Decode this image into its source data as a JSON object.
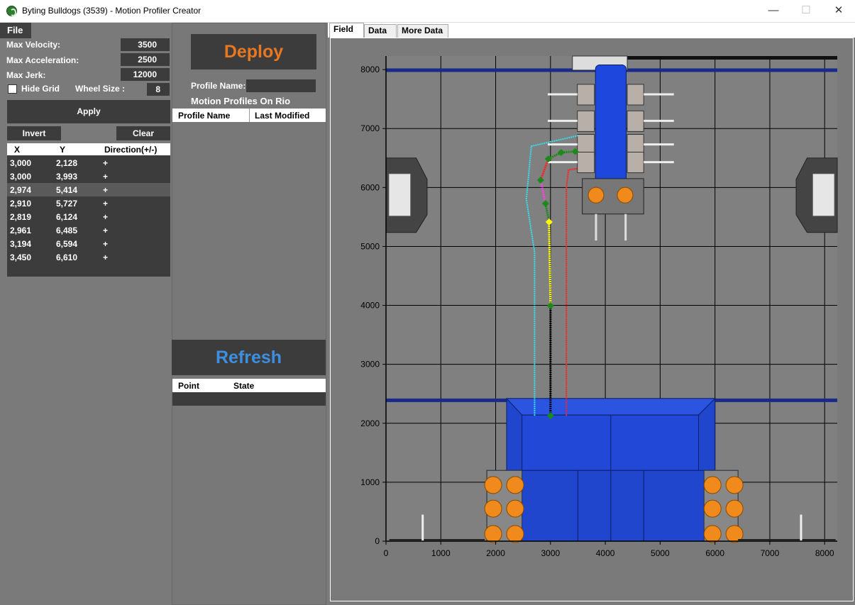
{
  "window": {
    "title": "Byting Bulldogs (3539) - Motion Profiler Creator",
    "min_glyph": "—",
    "max_glyph": "☐",
    "close_glyph": "✕"
  },
  "menu": {
    "file": "File"
  },
  "settings": {
    "max_velocity_label": "Max Velocity:",
    "max_velocity": "3500",
    "max_acceleration_label": "Max Acceleration:",
    "max_acceleration": "2500",
    "max_jerk_label": "Max Jerk:",
    "max_jerk": "12000",
    "hide_grid_label": "Hide Grid",
    "hide_grid_checked": false,
    "wheel_size_label": "Wheel Size :",
    "wheel_size": "8"
  },
  "buttons": {
    "apply": "Apply",
    "invert": "Invert",
    "clear": "Clear",
    "deploy": "Deploy",
    "refresh": "Refresh"
  },
  "points": {
    "columns": [
      "X",
      "Y",
      "Direction(+/-)"
    ],
    "rows": [
      {
        "x": "3,000",
        "y": "2,128",
        "dir": "+"
      },
      {
        "x": "3,000",
        "y": "3,993",
        "dir": "+"
      },
      {
        "x": "2,974",
        "y": "5,414",
        "dir": "+"
      },
      {
        "x": "2,910",
        "y": "5,727",
        "dir": "+"
      },
      {
        "x": "2,819",
        "y": "6,124",
        "dir": "+"
      },
      {
        "x": "2,961",
        "y": "6,485",
        "dir": "+"
      },
      {
        "x": "3,194",
        "y": "6,594",
        "dir": "+"
      },
      {
        "x": "3,450",
        "y": "6,610",
        "dir": "+"
      }
    ],
    "selected_index": 2
  },
  "profile": {
    "name_label": "Profile Name:",
    "name_value": "",
    "section_title": "Motion Profiles On Rio",
    "columns": [
      "Profile Name",
      "Last Modified"
    ]
  },
  "state_table": {
    "columns": [
      "Point",
      "State"
    ]
  },
  "tabs": [
    {
      "label": "Field",
      "active": true
    },
    {
      "label": "Data",
      "active": false
    },
    {
      "label": "More Data",
      "active": false
    }
  ],
  "colors": {
    "deploy": "#e87722",
    "refresh": "#3d8fe0",
    "path_black": "#000000",
    "path_yellow": "#ffff00",
    "path_magenta": "#ff44dd",
    "path_red": "#ff2020",
    "path_cyan": "#33e0ee",
    "path_green": "#1a8a1a",
    "field_blue": "#1f46cc"
  },
  "chart_data": {
    "type": "scatter",
    "x_ticks": [
      0,
      1000,
      2000,
      3000,
      4000,
      5000,
      6000,
      7000,
      8000
    ],
    "y_ticks": [
      0,
      1000,
      2000,
      3000,
      4000,
      5000,
      6000,
      7000,
      8000
    ],
    "xlim": [
      0,
      8230
    ],
    "ylim": [
      0,
      8230
    ],
    "grid": true,
    "waypoints": [
      [
        3000,
        2128
      ],
      [
        3000,
        3993
      ],
      [
        2974,
        5414
      ],
      [
        2910,
        5727
      ],
      [
        2819,
        6124
      ],
      [
        2961,
        6485
      ],
      [
        3194,
        6594
      ],
      [
        3450,
        6610
      ]
    ],
    "segments": [
      {
        "color": "black",
        "points": [
          [
            3000,
            2128
          ],
          [
            3000,
            3993
          ]
        ]
      },
      {
        "color": "yellow",
        "points": [
          [
            3000,
            3993
          ],
          [
            2974,
            5414
          ]
        ]
      },
      {
        "color": "green",
        "points": [
          [
            2974,
            5414
          ],
          [
            2910,
            5727
          ]
        ]
      },
      {
        "color": "magenta",
        "points": [
          [
            2910,
            5727
          ],
          [
            2819,
            6124
          ]
        ]
      },
      {
        "color": "red",
        "points": [
          [
            2819,
            6124
          ],
          [
            2961,
            6485
          ]
        ]
      },
      {
        "color": "green",
        "points": [
          [
            2961,
            6485
          ],
          [
            3194,
            6594
          ],
          [
            3450,
            6610
          ]
        ]
      }
    ],
    "right_trajectory": [
      [
        3290,
        2128
      ],
      [
        3290,
        6000
      ],
      [
        3330,
        6300
      ],
      [
        3500,
        6320
      ]
    ],
    "left_trajectory": [
      [
        2710,
        2128
      ],
      [
        2710,
        4900
      ],
      [
        2560,
        5800
      ],
      [
        2650,
        6700
      ],
      [
        3500,
        6880
      ]
    ]
  }
}
